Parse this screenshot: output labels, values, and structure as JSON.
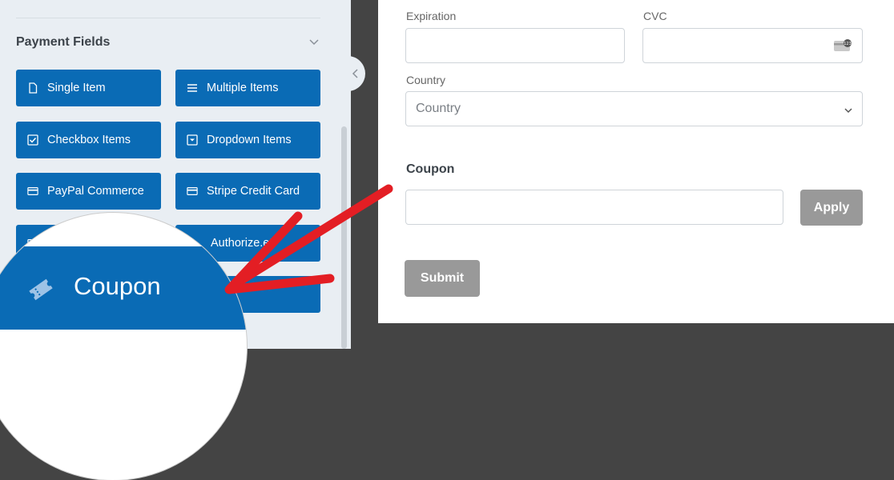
{
  "sidebar": {
    "section_title": "Payment Fields",
    "buttons": [
      {
        "label": "Single Item",
        "icon": "file-icon"
      },
      {
        "label": "Multiple Items",
        "icon": "list-icon"
      },
      {
        "label": "Checkbox Items",
        "icon": "checkbox-icon"
      },
      {
        "label": "Dropdown Items",
        "icon": "dropdown-icon"
      },
      {
        "label": "PayPal Commerce",
        "icon": "credit-card-icon"
      },
      {
        "label": "Stripe Credit Card",
        "icon": "credit-card-icon"
      },
      {
        "label": "Authorize.Net",
        "label_visible": "Authorize.et",
        "icon": "credit-card-icon"
      }
    ],
    "magnified_button": {
      "label": "Coupon",
      "icon": "ticket-icon"
    }
  },
  "form": {
    "expiration_label": "Expiration",
    "cvc_label": "CVC",
    "country_label": "Country",
    "country_placeholder": "Country",
    "coupon_label": "Coupon",
    "apply_label": "Apply",
    "submit_label": "Submit",
    "cvc_icon": "cvc-card-icon"
  },
  "colors": {
    "button_blue": "#0a6bb5",
    "arrow_red": "#e31e24",
    "disabled_gray": "#999999"
  }
}
